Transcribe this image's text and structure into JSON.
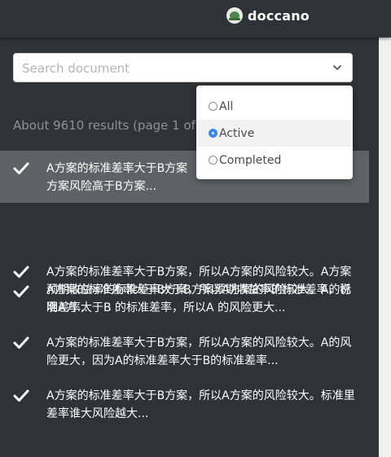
{
  "app": {
    "name": "doccano",
    "logo_icon": "doccano-logo-icon"
  },
  "search": {
    "placeholder": "Search document",
    "value": ""
  },
  "results": {
    "text": "About 9610 results (page 1 of 1"
  },
  "filter": {
    "options": [
      {
        "label": "All",
        "checked": false
      },
      {
        "label": "Active",
        "checked": true
      },
      {
        "label": "Completed",
        "checked": false
      }
    ]
  },
  "documents": [
    {
      "text": "A方案的标准差率大于B方案...方案风险高于B方案...",
      "line1": "A方案的标准差率大于B方案",
      "line2": "方案风险高于B方案...",
      "selected": true,
      "icon": "check-icon"
    },
    {
      "text": "A方案的标准差率大于B方案，所以A方案的风险较大。A方案预期收益率的标准差率大于B方案预期收益率的标准差率，说明A方...",
      "selected": false,
      "icon": "check-icon"
    },
    {
      "text": "A方案的标准差率大于B方案，所以A方案的风险较大。A的标准差率大于B 的标准差率，所以A 的风险更大...",
      "selected": false,
      "icon": "check-icon"
    },
    {
      "text": "A方案的标准差率大于B方案，所以A方案的风险较大。A的风险更大，因为A的标准差率大于B的标准差率...",
      "selected": false,
      "icon": "check-icon"
    },
    {
      "text": "A方案的标准差率大于B方案，所以A方案的风险较大。标准里差率谁大风险越大...",
      "selected": false,
      "icon": "check-icon"
    }
  ],
  "colors": {
    "background": "#2f3335",
    "selected_row": "#5d6263",
    "radio_active": "#3b86f5"
  }
}
